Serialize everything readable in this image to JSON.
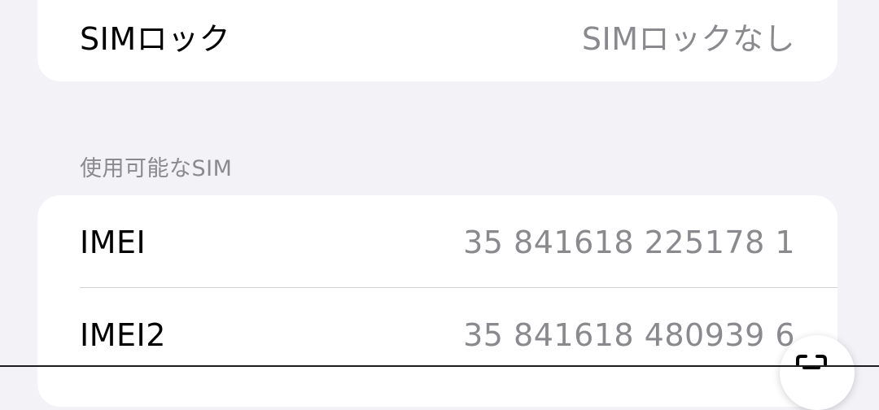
{
  "sim_lock": {
    "label": "SIMロック",
    "value": "SIMロックなし"
  },
  "available_sim": {
    "header": "使用可能なSIM",
    "rows": [
      {
        "label": "IMEI",
        "value": "35 841618 225178 1"
      },
      {
        "label": "IMEI2",
        "value": "35 841618 480939 6"
      }
    ]
  },
  "live_text_button": {
    "icon": "live-text-icon"
  },
  "colors": {
    "background": "#f2f2f7",
    "card": "#ffffff",
    "label": "#000000",
    "secondary": "#8a8a8e",
    "separator": "#d1d1d6"
  }
}
